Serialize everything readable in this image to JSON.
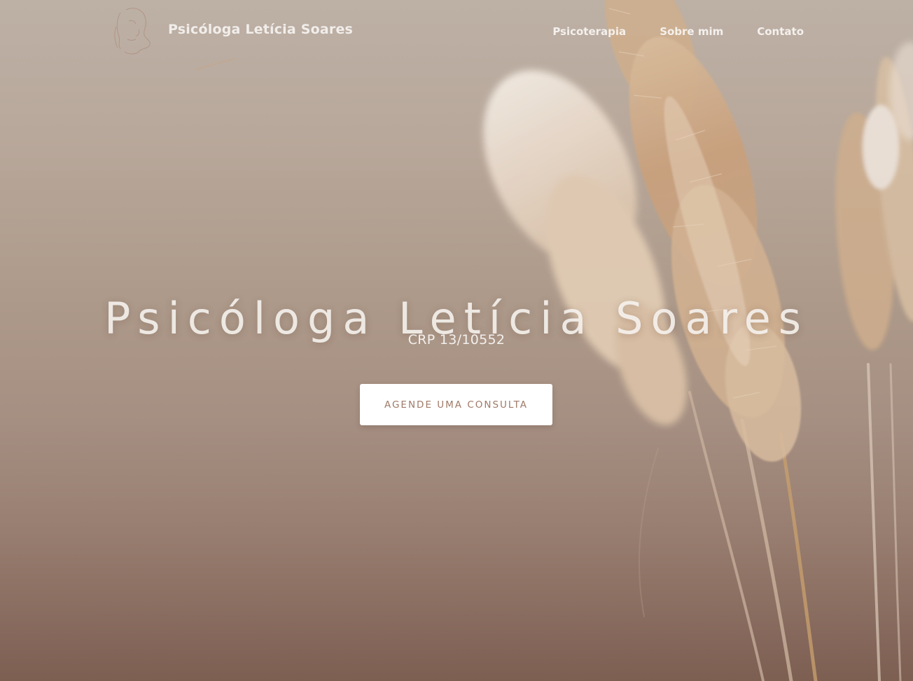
{
  "header": {
    "site_title": "Psicóloga Letícia Soares",
    "logo_icon": "face-line-art-logo"
  },
  "nav": {
    "items": [
      {
        "label": "Psicoterapia"
      },
      {
        "label": "Sobre mim"
      },
      {
        "label": "Contato"
      }
    ]
  },
  "hero": {
    "title": "Psicóloga Letícia Soares",
    "subtitle": "CRP 13/10552",
    "cta_label": "AGENDE UMA CONSULTA",
    "background": "pampas-grass-photo"
  },
  "colors": {
    "cta_text": "#a07967",
    "cta_background": "#ffffff",
    "background_top": "#bdb0a5",
    "background_bottom": "#7d5f52"
  }
}
